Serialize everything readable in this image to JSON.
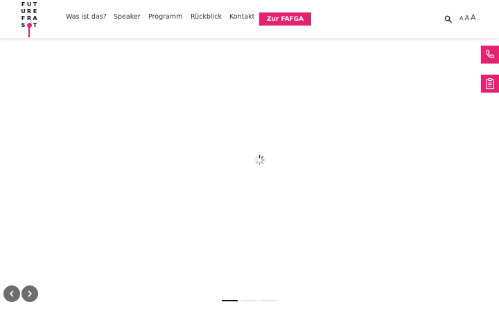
{
  "logo": {
    "rows": [
      [
        "F",
        "U",
        "T"
      ],
      [
        "U",
        "R",
        "E"
      ],
      [
        "F",
        "R",
        "A"
      ],
      [
        "S",
        "",
        "T"
      ]
    ],
    "accent": "#e5226f"
  },
  "nav": {
    "items": [
      {
        "label": "Was ist das?"
      },
      {
        "label": "Speaker"
      },
      {
        "label": "Programm"
      },
      {
        "label": "Rückblick"
      },
      {
        "label": "Kontakt"
      }
    ],
    "cta_label": "Zur FAFGA",
    "cta_color": "#e5226f"
  },
  "tools": {
    "search_icon": "search-icon",
    "font_sizes": [
      "A",
      "A",
      "A"
    ]
  },
  "side_tabs": [
    {
      "icon": "phone-icon"
    },
    {
      "icon": "clipboard-icon"
    }
  ],
  "slider": {
    "prev_icon": "chevron-left-icon",
    "next_icon": "chevron-right-icon",
    "total_slides": 3,
    "active_slide": 1
  }
}
